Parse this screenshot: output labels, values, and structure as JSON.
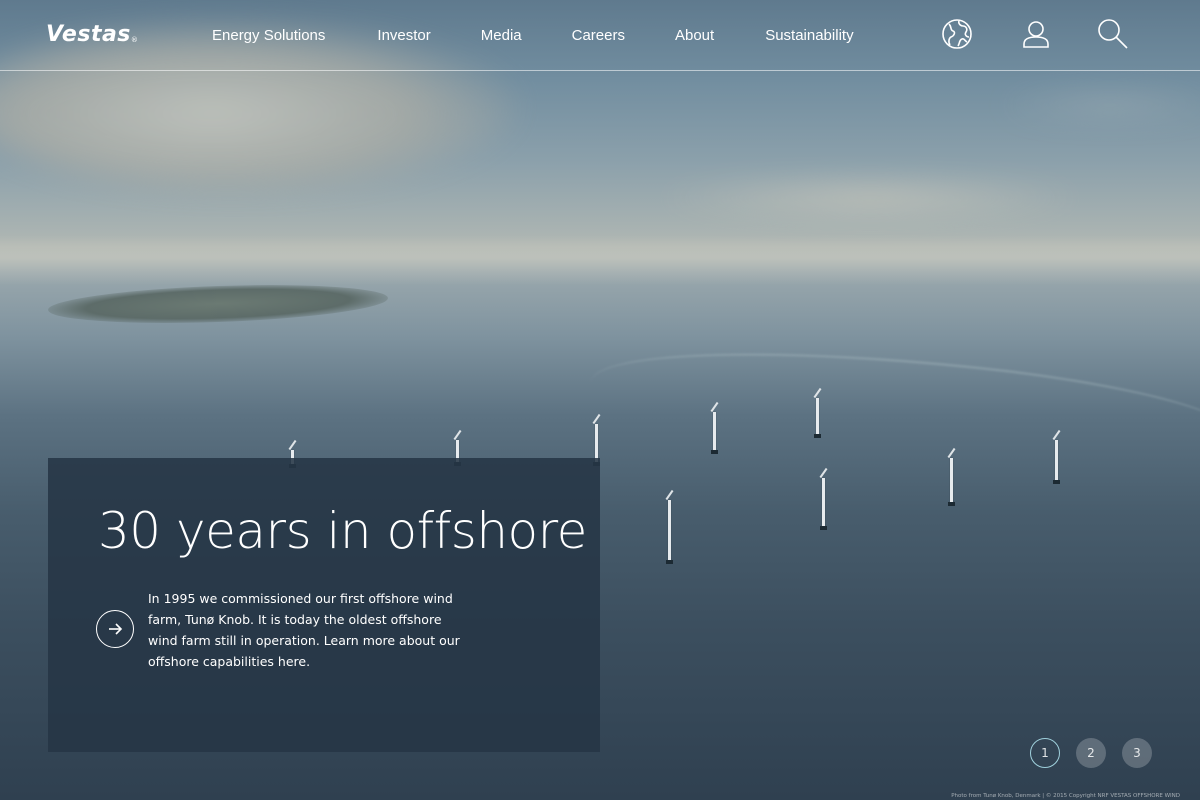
{
  "brand": {
    "logo_text": "Vestas",
    "logo_mark": "®"
  },
  "nav": {
    "items": [
      {
        "label": "Energy Solutions"
      },
      {
        "label": "Investor"
      },
      {
        "label": "Media"
      },
      {
        "label": "Careers"
      },
      {
        "label": "About"
      },
      {
        "label": "Sustainability"
      }
    ]
  },
  "header_icons": {
    "globe": "globe-icon",
    "user": "user-icon",
    "search": "search-icon"
  },
  "hero": {
    "title": "30 years in offshore",
    "body": "In 1995 we commissioned our first offshore wind farm, Tunø Knob. It is today the oldest offshore wind farm still in operation. Learn more about our offshore capabilities here.",
    "cta_icon": "arrow-right-icon"
  },
  "pager": {
    "pages": [
      "1",
      "2",
      "3"
    ],
    "active": "1"
  },
  "credit": "Photo from Tunø Knob, Denmark | © 2015 Copyright NRF VESTAS OFFSHORE WIND",
  "colors": {
    "card_bg": "#263546",
    "pager_active_ring": "#9fd0dc",
    "text": "#ffffff"
  }
}
